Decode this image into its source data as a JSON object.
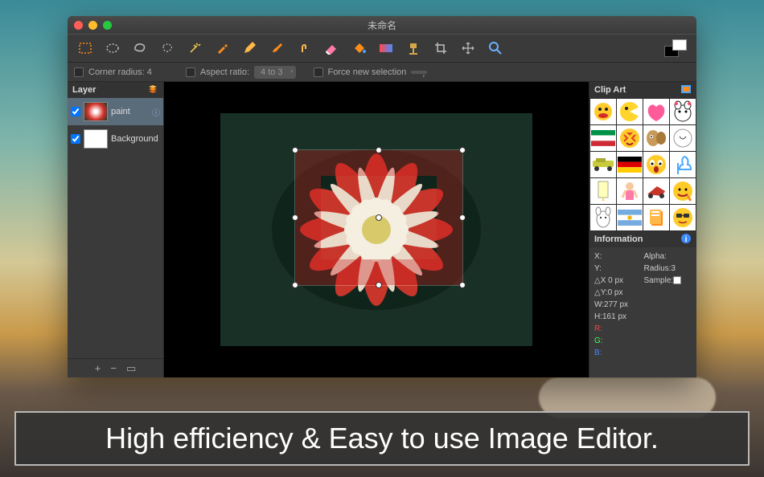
{
  "window": {
    "title": "未命名"
  },
  "toolbar": {
    "tools": [
      "rect-select",
      "ellipse-select",
      "lasso",
      "free-select",
      "magic-wand",
      "color-picker",
      "pencil",
      "brush",
      "finger",
      "eraser",
      "paint-bucket",
      "gradient",
      "clone-stamp",
      "crop",
      "move",
      "zoom"
    ]
  },
  "options": {
    "corner_label": "Corner radius: 4",
    "aspect_label": "Aspect ratio:",
    "aspect_value": "4 to 3",
    "force_label": "Force new selection"
  },
  "layers": {
    "header": "Layer",
    "items": [
      {
        "name": "paint",
        "selected": true,
        "thumb": "flower"
      },
      {
        "name": "Background",
        "selected": false,
        "thumb": "white"
      }
    ]
  },
  "clipart": {
    "header": "Clip Art"
  },
  "information": {
    "header": "Information",
    "x_label": "X:",
    "y_label": "Y:",
    "dx_label": "△X 0 px",
    "dy_label": "△Y:0 px",
    "w_label": "W:277 px",
    "h_label": "H:161 px",
    "alpha_label": "Alpha:",
    "radius_label": "Radius:3",
    "sample_label": "Sample:",
    "r_label": "R:",
    "g_label": "G:",
    "b_label": "B:"
  },
  "caption": "High efficiency & Easy to use Image Editor."
}
